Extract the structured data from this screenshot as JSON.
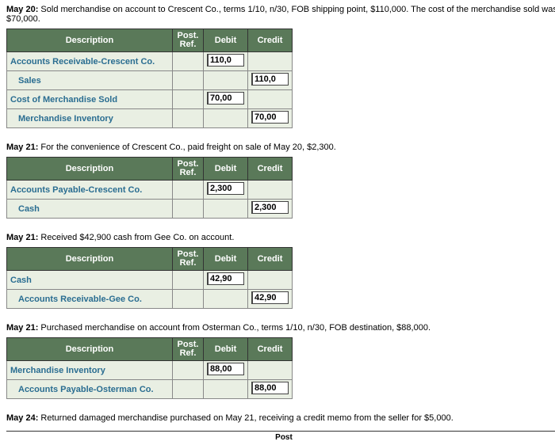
{
  "entries": [
    {
      "narrative_date": "May 20:",
      "narrative_text": " Sold merchandise on account to Crescent Co., terms 1/10, n/30, FOB shipping point, $110,000. The cost of the merchandise sold was $70,000.",
      "headers": {
        "desc": "Description",
        "postref": "Post.\nRef.",
        "debit": "Debit",
        "credit": "Credit"
      },
      "rows": [
        {
          "acct": "Accounts Receivable-Crescent Co.",
          "indent": false,
          "debit": "110,0",
          "credit": ""
        },
        {
          "acct": "Sales",
          "indent": true,
          "debit": "",
          "credit": "110,0"
        },
        {
          "acct": "Cost of Merchandise Sold",
          "indent": false,
          "debit": "70,00",
          "credit": ""
        },
        {
          "acct": "Merchandise Inventory",
          "indent": true,
          "debit": "",
          "credit": "70,00"
        }
      ]
    },
    {
      "narrative_date": "May 21:",
      "narrative_text": " For the convenience of Crescent Co., paid freight on sale of May 20, $2,300.",
      "headers": {
        "desc": "Description",
        "postref": "Post.\nRef.",
        "debit": "Debit",
        "credit": "Credit"
      },
      "rows": [
        {
          "acct": "Accounts Payable-Crescent Co.",
          "indent": false,
          "debit": "2,300",
          "credit": ""
        },
        {
          "acct": "Cash",
          "indent": true,
          "debit": "",
          "credit": "2,300"
        }
      ]
    },
    {
      "narrative_date": "May 21:",
      "narrative_text": " Received $42,900 cash from Gee Co. on account.",
      "headers": {
        "desc": "Description",
        "postref": "Post.\nRef.",
        "debit": "Debit",
        "credit": "Credit"
      },
      "rows": [
        {
          "acct": "Cash",
          "indent": false,
          "debit": "42,90",
          "credit": ""
        },
        {
          "acct": "Accounts Receivable-Gee Co.",
          "indent": true,
          "debit": "",
          "credit": "42,90"
        }
      ]
    },
    {
      "narrative_date": "May 21:",
      "narrative_text": " Purchased merchandise on account from Osterman Co., terms 1/10, n/30, FOB destination, $88,000.",
      "headers": {
        "desc": "Description",
        "postref": "Post.\nRef.",
        "debit": "Debit",
        "credit": "Credit"
      },
      "rows": [
        {
          "acct": "Merchandise Inventory",
          "indent": false,
          "debit": "88,00",
          "credit": ""
        },
        {
          "acct": "Accounts Payable-Osterman Co.",
          "indent": true,
          "debit": "",
          "credit": "88,00"
        }
      ]
    }
  ],
  "final": {
    "narrative_date": "May 24:",
    "narrative_text": " Returned damaged merchandise purchased on May 21, receiving a credit memo from the seller for $5,000.",
    "partial_header": "Post"
  }
}
